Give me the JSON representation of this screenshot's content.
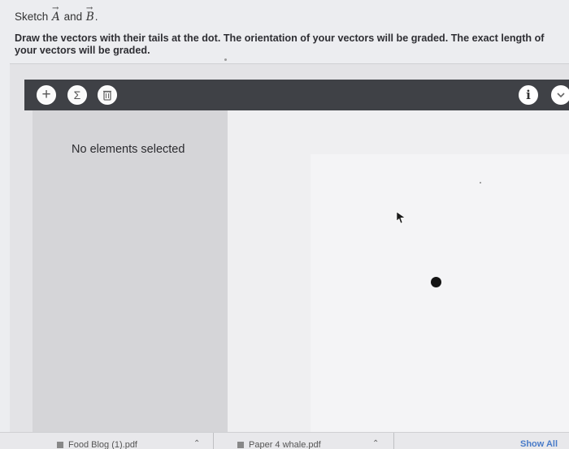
{
  "question": {
    "prompt_prefix": "Sketch",
    "vector_a": "A",
    "conjunction": "and",
    "vector_b": "B",
    "period": ".",
    "instructions": "Draw the vectors with their tails at the dot. The orientation of your vectors will be graded. The exact length of your vectors will be graded."
  },
  "toolbar": {
    "add_label": "+",
    "sigma_label": "Σ",
    "trash_label": "☲",
    "info_label": "i",
    "menu_label": "⌄"
  },
  "left_panel": {
    "empty_message": "No elements selected"
  },
  "download_bar": {
    "items": [
      {
        "name": "Food Blog (1).pdf"
      },
      {
        "name": "Paper 4 whale.pdf"
      }
    ],
    "show_all_label": "Show All"
  }
}
